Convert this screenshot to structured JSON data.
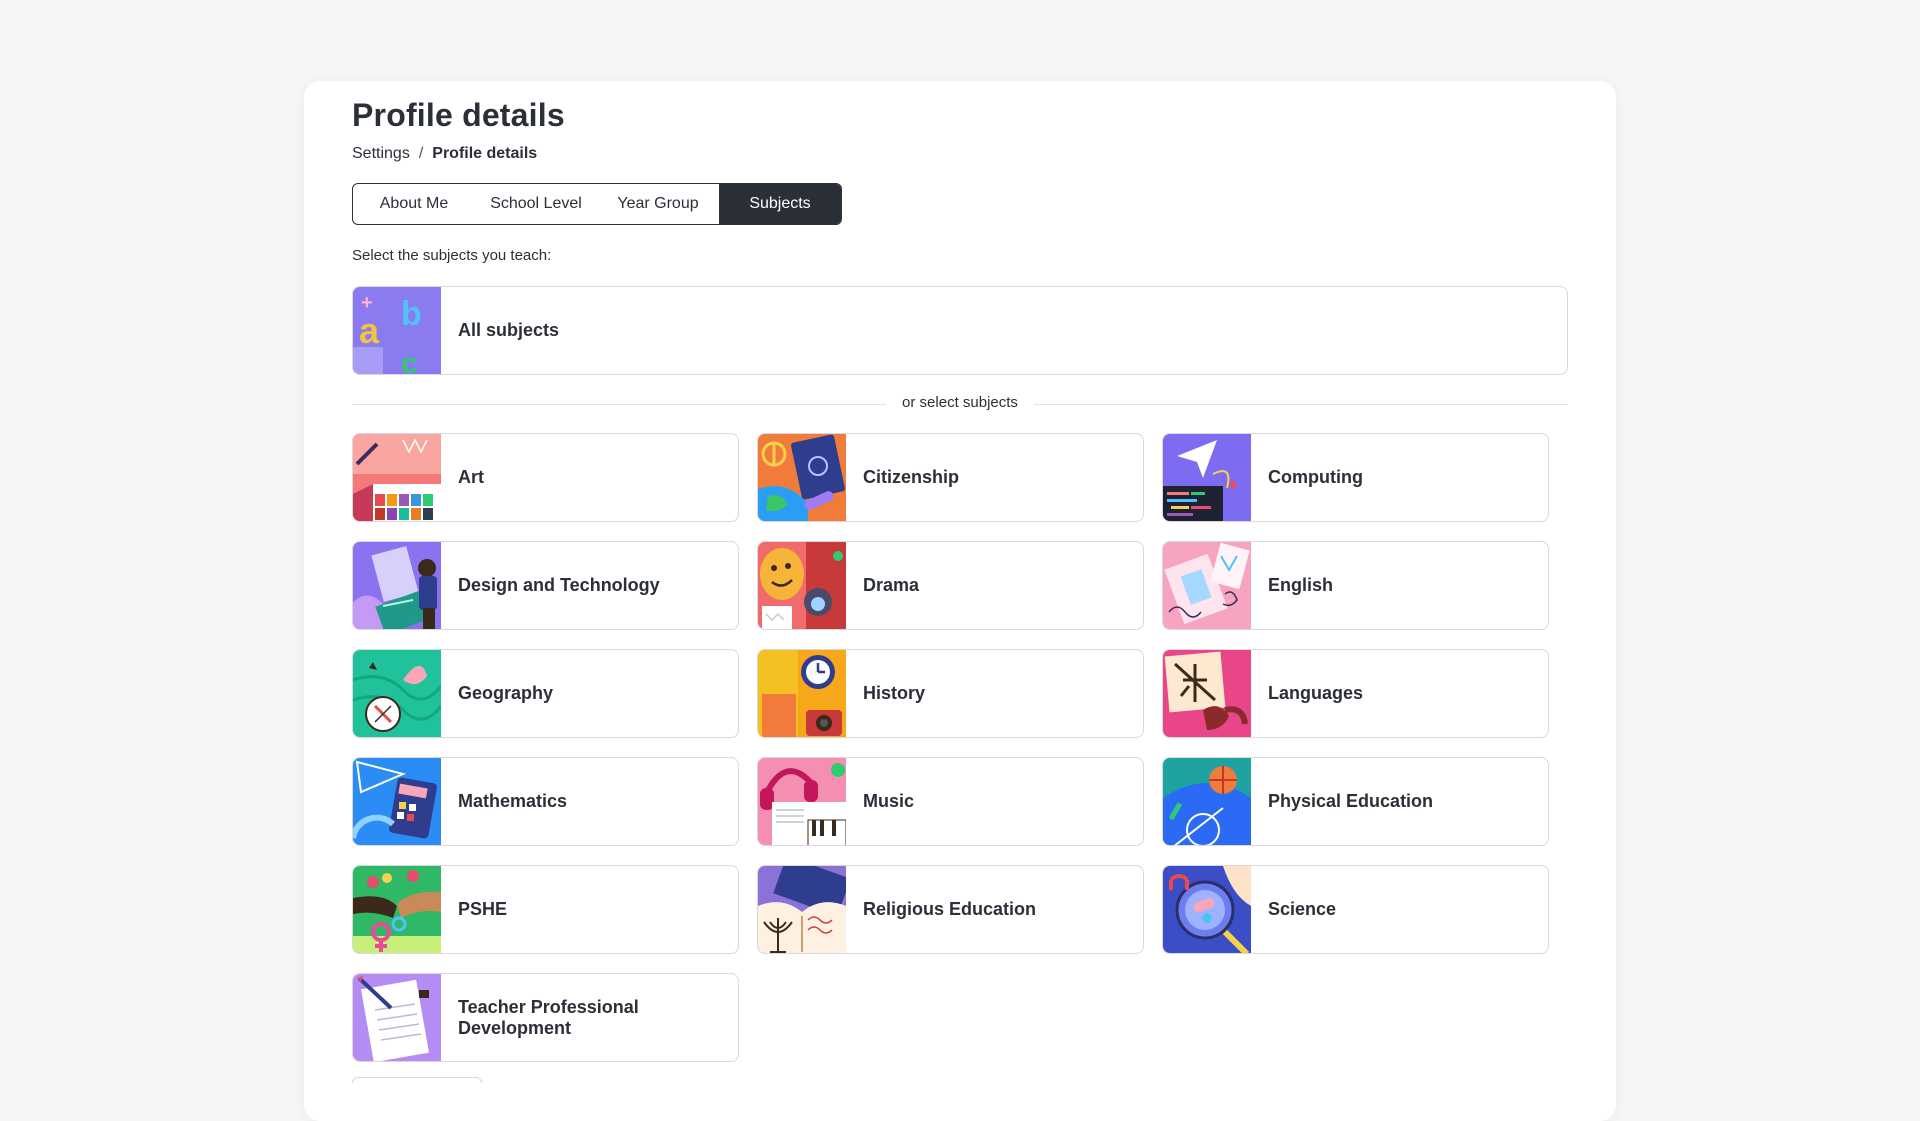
{
  "page": {
    "title": "Profile details",
    "breadcrumb": {
      "parent": "Settings",
      "separator": "/",
      "current": "Profile details"
    }
  },
  "tabs": [
    {
      "label": "About Me",
      "active": false
    },
    {
      "label": "School Level",
      "active": false
    },
    {
      "label": "Year Group",
      "active": false
    },
    {
      "label": "Subjects",
      "active": true
    }
  ],
  "instructions": "Select the subjects you teach:",
  "all_subjects": {
    "label": "All subjects",
    "icon": "alphabet-letters-icon"
  },
  "divider_label": "or select subjects",
  "subjects": [
    {
      "label": "Art",
      "icon": "art-palette-icon"
    },
    {
      "label": "Citizenship",
      "icon": "citizenship-passport-icon"
    },
    {
      "label": "Computing",
      "icon": "computing-code-icon"
    },
    {
      "label": "Design and Technology",
      "icon": "design-technology-icon"
    },
    {
      "label": "Drama",
      "icon": "drama-masks-icon"
    },
    {
      "label": "English",
      "icon": "english-book-icon"
    },
    {
      "label": "Geography",
      "icon": "geography-compass-icon"
    },
    {
      "label": "History",
      "icon": "history-clock-icon"
    },
    {
      "label": "Languages",
      "icon": "languages-characters-icon"
    },
    {
      "label": "Mathematics",
      "icon": "mathematics-calculator-icon"
    },
    {
      "label": "Music",
      "icon": "music-headphones-icon"
    },
    {
      "label": "Physical Education",
      "icon": "physical-education-ball-icon"
    },
    {
      "label": "PSHE",
      "icon": "pshe-hands-icon"
    },
    {
      "label": "Religious Education",
      "icon": "religious-education-menorah-icon"
    },
    {
      "label": "Science",
      "icon": "science-magnifier-icon"
    },
    {
      "label": "Teacher Professional Development",
      "icon": "teacher-development-notepad-icon"
    }
  ],
  "colors": {
    "text": "#2b2f38",
    "active_tab_bg": "#2b2f38",
    "tile_border": "#d9d9dc",
    "page_bg": "#f6f6f6"
  }
}
